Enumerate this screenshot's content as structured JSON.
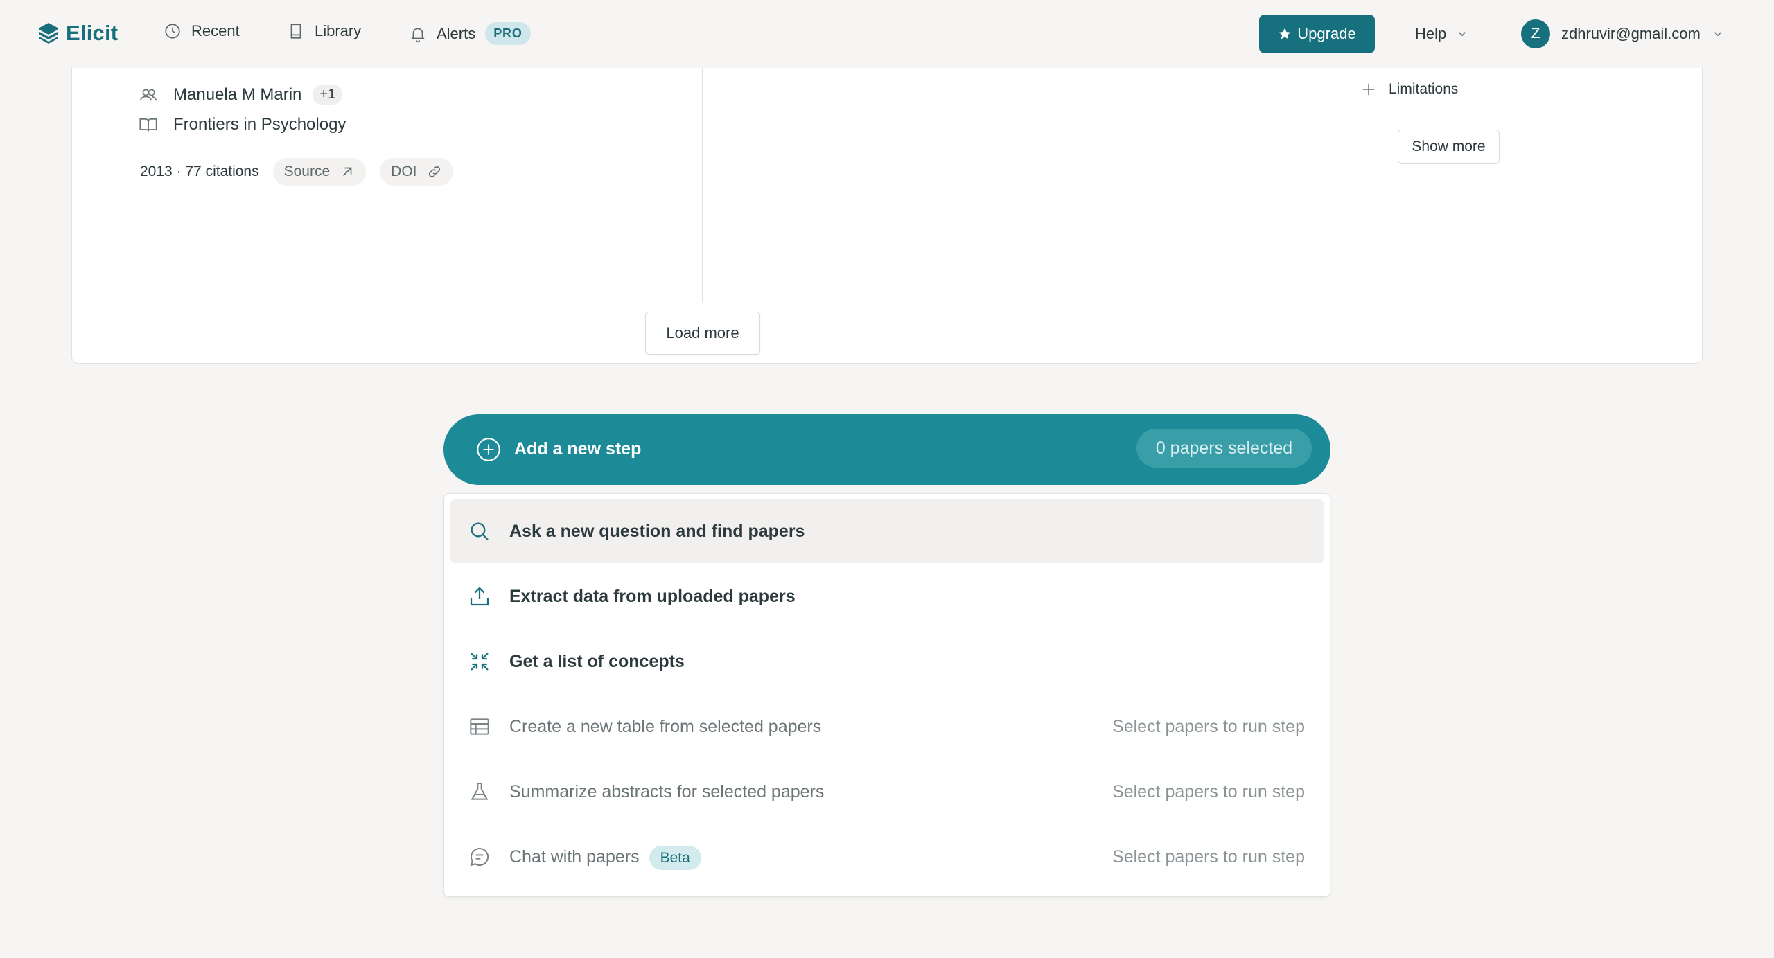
{
  "header": {
    "brand": "Elicit",
    "nav": [
      {
        "label": "Recent",
        "icon": "clock-icon"
      },
      {
        "label": "Library",
        "icon": "book-icon"
      },
      {
        "label": "Alerts",
        "icon": "bell-icon",
        "badge": "PRO"
      }
    ],
    "upgrade_label": "Upgrade",
    "help_label": "Help",
    "user_initial": "Z",
    "user_email": "zdhruvir@gmail.com"
  },
  "paper": {
    "authors": "Manuela M Marin",
    "more_authors": "+1",
    "journal": "Frontiers in Psychology",
    "stats": "2013 · 77 citations",
    "source_label": "Source",
    "doi_label": "DOI"
  },
  "results": {
    "load_more_label": "Load more"
  },
  "sidebar": {
    "limitations_label": "Limitations",
    "show_more_label": "Show more"
  },
  "add_step": {
    "label": "Add a new step",
    "selected_count": "0 papers selected"
  },
  "menu": {
    "items": [
      {
        "label": "Ask a new question and find papers",
        "icon": "search-icon",
        "hint": ""
      },
      {
        "label": "Extract data from uploaded papers",
        "icon": "upload-icon",
        "hint": ""
      },
      {
        "label": "Get a list of concepts",
        "icon": "concepts-icon",
        "hint": ""
      },
      {
        "label": "Create a new table from selected papers",
        "icon": "table-icon",
        "hint": "Select papers to run step"
      },
      {
        "label": "Summarize abstracts for selected papers",
        "icon": "flask-icon",
        "hint": "Select papers to run step"
      },
      {
        "label": "Chat with papers",
        "icon": "chat-icon",
        "hint": "Select papers to run step",
        "badge": "Beta"
      }
    ]
  },
  "colors": {
    "brand": "#17707d",
    "add_step_bg": "#1c8a97",
    "page_bg": "#f6f5f4"
  }
}
